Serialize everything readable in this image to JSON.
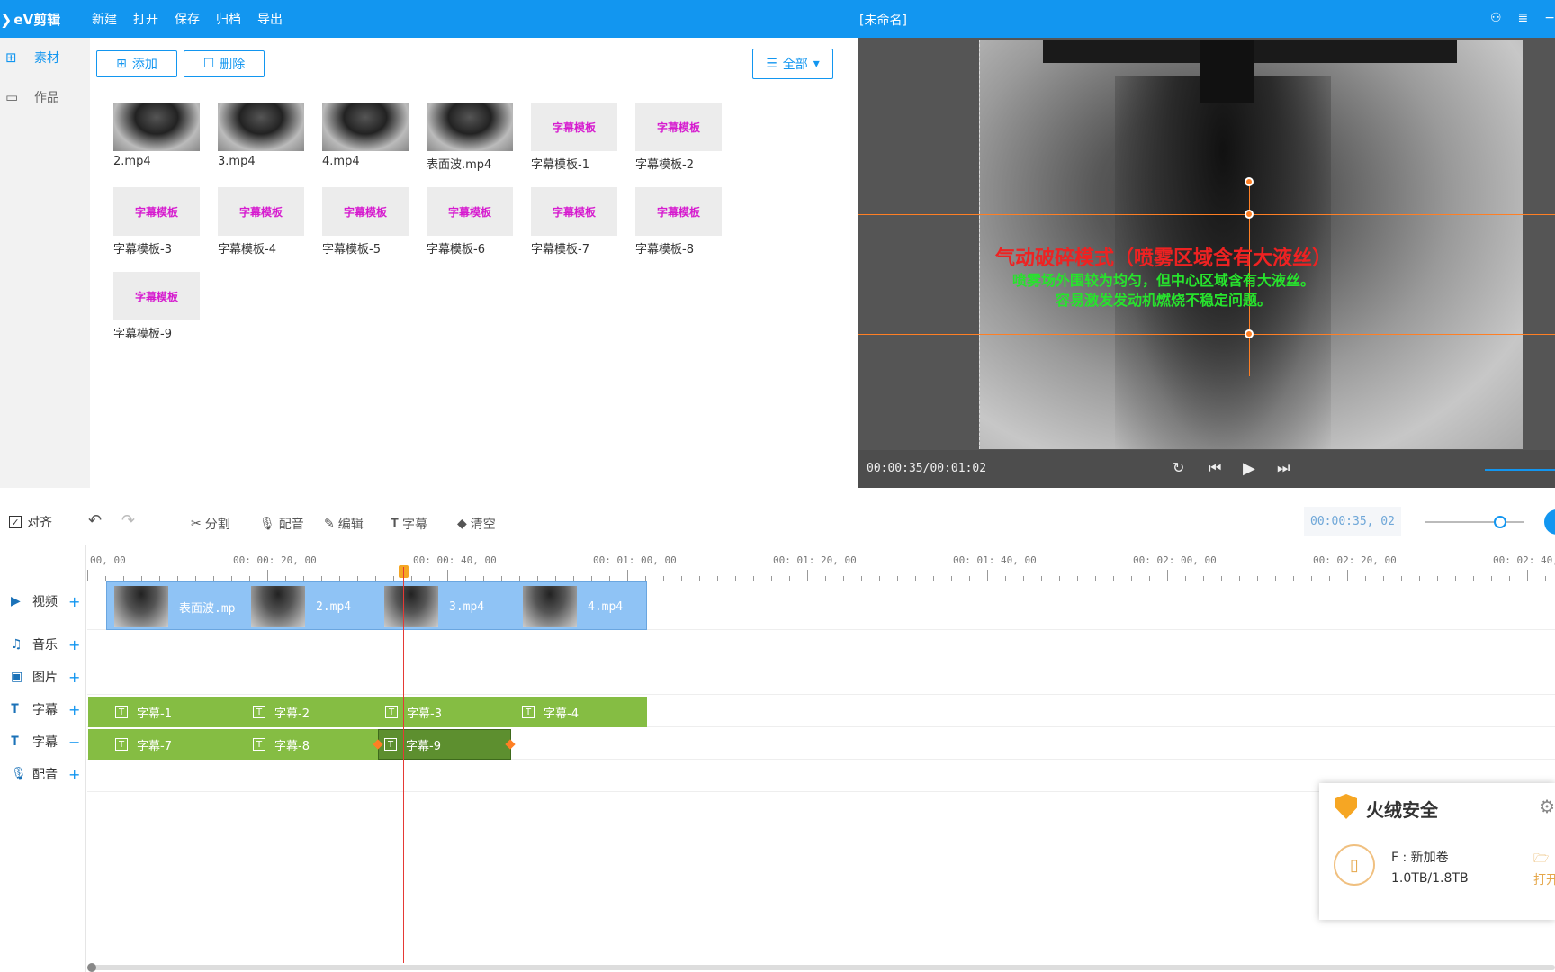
{
  "app": {
    "logo_text": "eV剪辑",
    "title": "[未命名]",
    "menu": [
      "新建",
      "打开",
      "保存",
      "归档",
      "导出"
    ]
  },
  "sidebar": {
    "items": [
      {
        "label": "素材",
        "icon": "grid-icon",
        "active": true
      },
      {
        "label": "作品",
        "icon": "folder-icon",
        "active": false
      }
    ]
  },
  "media": {
    "add_label": "添加",
    "delete_label": "删除",
    "filter_label": "全部",
    "template_text": "字幕模板",
    "items": [
      {
        "name": "2.mp4",
        "kind": "video"
      },
      {
        "name": "3.mp4",
        "kind": "video"
      },
      {
        "name": "4.mp4",
        "kind": "video"
      },
      {
        "name": "表面波.mp4",
        "kind": "video"
      },
      {
        "name": "字幕模板-1",
        "kind": "template"
      },
      {
        "name": "字幕模板-2",
        "kind": "template"
      },
      {
        "name": "字幕模板-3",
        "kind": "template"
      },
      {
        "name": "字幕模板-4",
        "kind": "template"
      },
      {
        "name": "字幕模板-5",
        "kind": "template"
      },
      {
        "name": "字幕模板-6",
        "kind": "template"
      },
      {
        "name": "字幕模板-7",
        "kind": "template"
      },
      {
        "name": "字幕模板-8",
        "kind": "template"
      },
      {
        "name": "字幕模板-9",
        "kind": "template"
      }
    ]
  },
  "preview": {
    "caption_title": "气动破碎模式（喷雾区域含有大液丝）",
    "caption_line1": "喷雾场外围较为均匀，但中心区域含有大液丝。",
    "caption_line2": "容易激发发动机燃烧不稳定问题。",
    "time": "00:00:35/00:01:02"
  },
  "timeline": {
    "toolbar": {
      "align_label": "对齐",
      "split_label": "分割",
      "dub_label": "配音",
      "edit_label": "编辑",
      "subtitle_label": "字幕",
      "clear_label": "清空",
      "current_time": "00:00:35, 02"
    },
    "ruler": [
      "00, 00",
      "00: 00: 20, 00",
      "00: 00: 40, 00",
      "00: 01: 00, 00",
      "00: 01: 20, 00",
      "00: 01: 40, 00",
      "00: 02: 00, 00",
      "00: 02: 20, 00",
      "00: 02: 40, 00"
    ],
    "tracks": [
      {
        "label": "视频",
        "action": "+"
      },
      {
        "label": "音乐",
        "action": "+"
      },
      {
        "label": "图片",
        "action": "+"
      },
      {
        "label": "字幕",
        "action": "+"
      },
      {
        "label": "字幕",
        "action": "−"
      },
      {
        "label": "配音",
        "action": "+"
      }
    ],
    "video_clips": [
      "表面波.mp",
      "2.mp4",
      "3.mp4",
      "4.mp4"
    ],
    "subtitle_row1": [
      "字幕-1",
      "字幕-2",
      "字幕-3",
      "字幕-4"
    ],
    "subtitle_row2": [
      "字幕-7",
      "字幕-8",
      "字幕-9"
    ],
    "accent_color": "#1296f0",
    "subtitle_color": "#85bd43"
  },
  "popup": {
    "title": "火绒安全",
    "drive": "F : 新加卷",
    "size": "1.0TB/1.8TB",
    "open_label": "打开"
  }
}
